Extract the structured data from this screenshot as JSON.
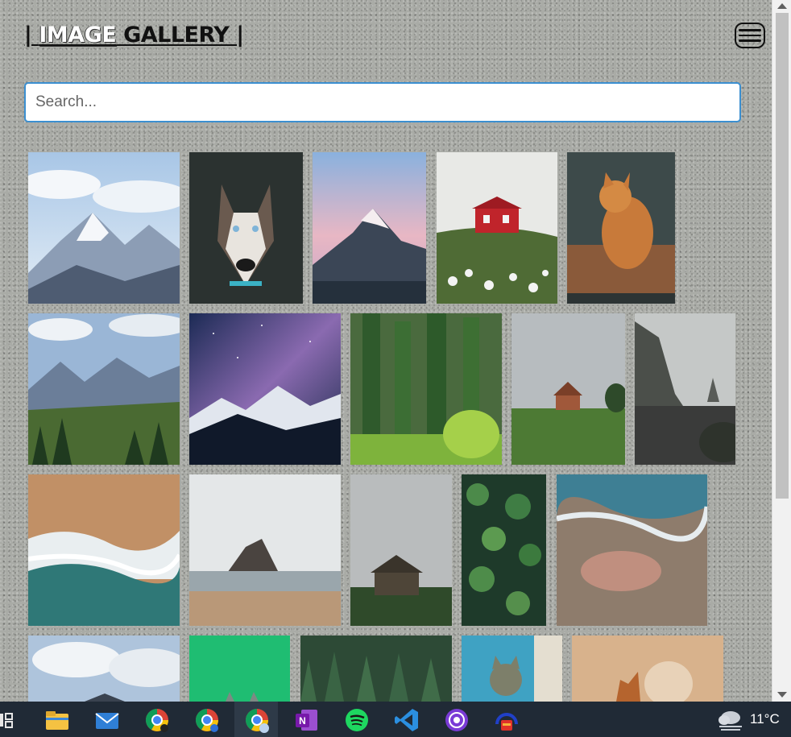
{
  "header": {
    "title_prefix": "| ",
    "title_accent": "IMAGE",
    "title_rest": " GALLERY |",
    "menu_icon": "hamburger-menu-icon"
  },
  "search": {
    "placeholder": "Search...",
    "value": ""
  },
  "gallery": {
    "images": [
      {
        "subject": "snowy-mountain-range"
      },
      {
        "subject": "husky-dog"
      },
      {
        "subject": "pink-sunset-peak"
      },
      {
        "subject": "red-cabin-on-hill"
      },
      {
        "subject": "orange-cat"
      },
      {
        "subject": "mountain-valley-forest"
      },
      {
        "subject": "milky-way-mountains"
      },
      {
        "subject": "pine-forest"
      },
      {
        "subject": "foggy-hut"
      },
      {
        "subject": "dark-coast-rocks"
      },
      {
        "subject": "aerial-beach-waves"
      },
      {
        "subject": "haystack-rock-beach"
      },
      {
        "subject": "old-barn-fog"
      },
      {
        "subject": "aerial-tree-canopy"
      },
      {
        "subject": "aerial-ocean-shore"
      },
      {
        "subject": "clouds-and-house"
      },
      {
        "subject": "green-backdrop-cat"
      },
      {
        "subject": "dense-forest"
      },
      {
        "subject": "cat-peeking-window"
      },
      {
        "subject": "two-dogs"
      }
    ]
  },
  "taskbar": {
    "apps": [
      "task-view-icon",
      "file-explorer-icon",
      "mail-icon",
      "chrome-icon",
      "chrome-profile-p-icon",
      "chrome-profile-user-icon",
      "onenote-icon",
      "spotify-icon",
      "vscode-icon",
      "podcast-icon",
      "audio-app-icon"
    ],
    "weather_icon": "cloud-weather-icon",
    "temperature": "11°C"
  },
  "colors": {
    "accent": "#3b8fd0",
    "background": "#a9aba6",
    "taskbar": "#202a36"
  }
}
